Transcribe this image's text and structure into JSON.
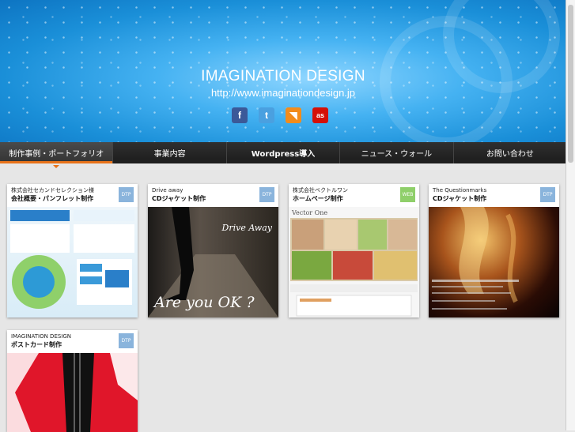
{
  "header": {
    "title": "IMAGINATION DESIGN",
    "url": "http://www.imaginationdesign.jp",
    "social": [
      {
        "name": "facebook-icon",
        "glyph": "f"
      },
      {
        "name": "twitter-icon",
        "glyph": "t"
      },
      {
        "name": "rss-icon",
        "glyph": "◥"
      },
      {
        "name": "lastfm-icon",
        "glyph": "as"
      }
    ]
  },
  "nav": {
    "items": [
      {
        "label": "制作事例・ポートフォリオ",
        "active": true
      },
      {
        "label": "事業内容",
        "active": false
      },
      {
        "label": "Wordpress導入",
        "active": false
      },
      {
        "label": "ニュース・ウォール",
        "active": false
      },
      {
        "label": "お問い合わせ",
        "active": false
      }
    ]
  },
  "portfolio": [
    {
      "client": "株式会社セカンドセレクション様",
      "title": "会社概要・パンフレット制作",
      "tag": "DTP"
    },
    {
      "client": "Drive away",
      "title": "CDジャケット制作",
      "tag": "DTP",
      "image_text": [
        "Drive Away",
        "Are you OK ?"
      ]
    },
    {
      "client": "株式会社ベクトルワン",
      "title": "ホームページ制作",
      "tag": "WEB",
      "image_text": [
        "Vector One"
      ]
    },
    {
      "client": "The Questionmarks",
      "title": "CDジャケット制作",
      "tag": "DTP"
    },
    {
      "client": "IMAGINATION DESIGN",
      "title": "ポストカード制作",
      "tag": "DTP"
    }
  ],
  "colors": {
    "accent": "#e8731a",
    "nav_bg": "#1c1c1c",
    "dtp_tag": "#8ab4dc",
    "web_tag": "#8fcf6a"
  }
}
